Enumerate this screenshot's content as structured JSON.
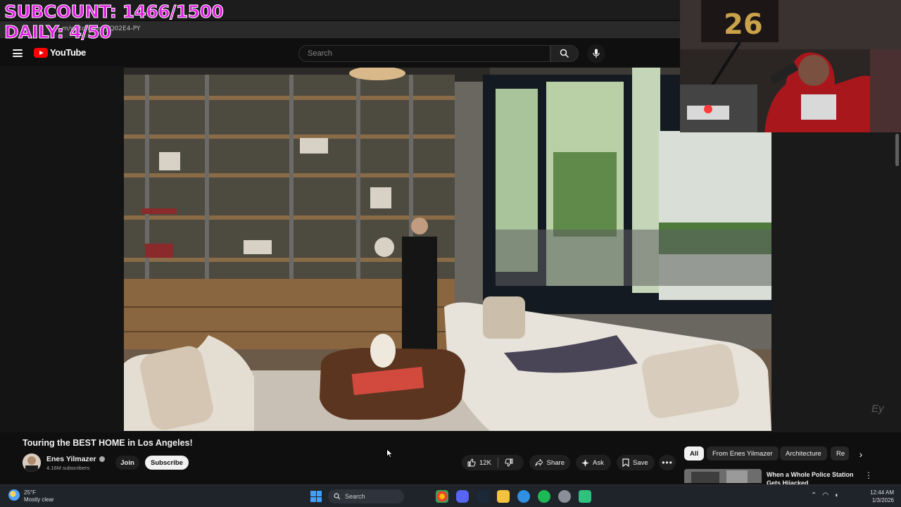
{
  "overlay": {
    "subcount": "SUBCOUNT: 1466/1500",
    "daily": "DAILY: 4/50"
  },
  "browser": {
    "url": "m/watch?v=vjfQ02E4-PY"
  },
  "header": {
    "logo_text": "YouTube",
    "search_placeholder": "Search"
  },
  "video": {
    "title": "Touring the BEST HOME in Los Angeles!",
    "watermark": "Ey"
  },
  "channel": {
    "name": "Enes Yilmazer",
    "subscribers": "4.16M subscribers",
    "join_label": "Join",
    "subscribe_label": "Subscribe"
  },
  "actions": {
    "like_count": "12K",
    "share_label": "Share",
    "ask_label": "Ask",
    "save_label": "Save",
    "more_label": "•••"
  },
  "chips": [
    {
      "label": "All",
      "active": true
    },
    {
      "label": "From Enes Yilmazer",
      "active": false
    },
    {
      "label": "Architecture",
      "active": false
    },
    {
      "label": "Re",
      "active": false
    }
  ],
  "recommendation": {
    "title": "When a Whole Police Station Gets Hijacked"
  },
  "taskbar": {
    "temp": "25°F",
    "condition": "Mostly clear",
    "search_label": "Search",
    "time": "12:44 AM",
    "date": "1/3/2026"
  },
  "colors": {
    "youtube_red": "#ff0000",
    "overlay_magenta": "#e020e0",
    "background": "#0f0f0f"
  }
}
